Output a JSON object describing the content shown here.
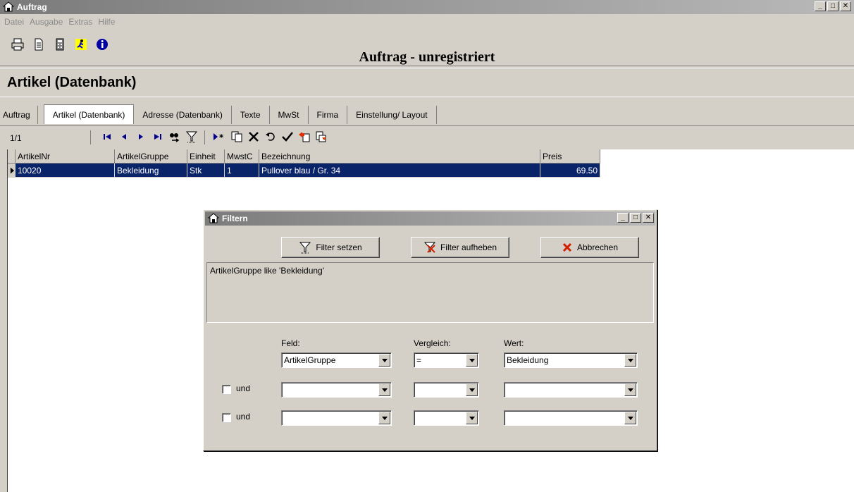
{
  "window": {
    "title": "Auftrag"
  },
  "menu": [
    "Datei",
    "Ausgabe",
    "Extras",
    "Hilfe"
  ],
  "app_heading": "Auftrag - unregistriert",
  "section_title": "Artikel (Datenbank)",
  "tabs": [
    {
      "label": "Auftrag"
    },
    {
      "label": "Artikel (Datenbank)"
    },
    {
      "label": "Adresse (Datenbank)"
    },
    {
      "label": "Texte"
    },
    {
      "label": "MwSt"
    },
    {
      "label": "Firma"
    },
    {
      "label": "Einstellung/ Layout"
    }
  ],
  "navigator": {
    "record_count": "1/1"
  },
  "grid": {
    "columns": [
      "ArtikelNr",
      "ArtikelGruppe",
      "Einheit",
      "MwstC",
      "Bezeichnung",
      "Preis"
    ],
    "rows": [
      {
        "artikelnr": "10020",
        "gruppe": "Bekleidung",
        "einheit": "Stk",
        "mwst": "1",
        "bezeichnung": "Pullover blau / Gr. 34",
        "preis": "69.50"
      }
    ]
  },
  "dialog": {
    "title": "Filtern",
    "btn_set": "Filter setzen",
    "btn_remove": "Filter aufheben",
    "btn_cancel": "Abbrechen",
    "filter_expression": "ArtikelGruppe like 'Bekleidung'",
    "label_field": "Feld:",
    "label_compare": "Vergleich:",
    "label_value": "Wert:",
    "rows": [
      {
        "field": "ArtikelGruppe",
        "compare": "=",
        "value": "Bekleidung"
      },
      {
        "and_label": "und",
        "field": "",
        "compare": "",
        "value": ""
      },
      {
        "and_label": "und",
        "field": "",
        "compare": "",
        "value": ""
      }
    ]
  }
}
